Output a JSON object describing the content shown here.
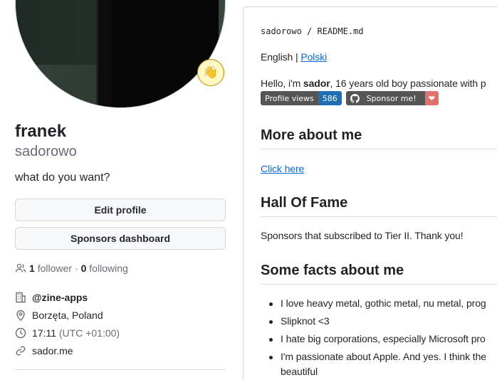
{
  "profile": {
    "status_emoji": "👋",
    "name": "franek",
    "login": "sadorowo",
    "bio": "what do you want?",
    "edit_label": "Edit profile",
    "sponsors_label": "Sponsors dashboard",
    "followers": "1",
    "followers_label": "follower",
    "following": "0",
    "following_label": "following",
    "org": "@zine-apps",
    "location": "Borzęta, Poland",
    "time": "17:11",
    "tz": "(UTC +01:00)",
    "website": "sador.me"
  },
  "readme": {
    "owner": "sadorowo",
    "file": "README.md",
    "lang_current": "English",
    "lang_sep": "|",
    "lang_link": "Polski",
    "hello_pre": "Hello, i'm ",
    "hello_name": "sador",
    "hello_post": ", 16 years old boy passionate with p",
    "badge_views_label": "Profile views",
    "badge_views_value": "586",
    "badge_sponsor_label": "Sponsor me!",
    "h_more": "More about me",
    "click_here": "Click here",
    "h_hall": "Hall Of Fame",
    "hall_text": "Sponsors that subscribed to Tier II. Thank you!",
    "h_facts": "Some facts about me",
    "facts": [
      "I love heavy metal, gothic metal, nu metal, prog",
      "Slipknot <3",
      "I hate big corporations, especially Microsoft pro",
      "I'm passionate about Apple. And yes. I think the"
    ],
    "facts_cont": "beautiful"
  },
  "colors": {
    "link": "#0969da",
    "badge_views": "#1e6fb5",
    "badge_heart": "#e2706f"
  }
}
